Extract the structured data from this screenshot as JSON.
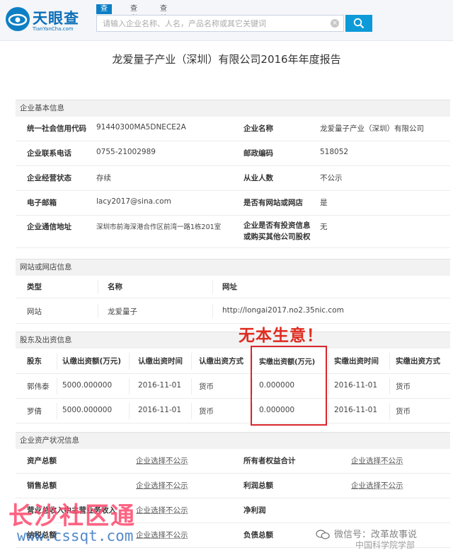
{
  "header": {
    "logo_name": "天眼查",
    "logo_sub": "TianYanCha.com",
    "tabs": [
      "查公司",
      "查老板",
      "查关系"
    ],
    "search_placeholder": "请输入企业名称、人名，产品名称或其它关键词"
  },
  "report_title": "龙爱量子产业（深圳）有限公司2016年年度报告",
  "basic_info": {
    "section_title": "企业基本信息",
    "rows": [
      {
        "l1": "统一社会信用代码",
        "v1": "91440300MA5DNECE2A",
        "l2": "企业名称",
        "v2": "龙爱量子产业（深圳）有限公司"
      },
      {
        "l1": "企业联系电话",
        "v1": "0755-21002989",
        "l2": "邮政编码",
        "v2": "518052"
      },
      {
        "l1": "企业经营状态",
        "v1": "存续",
        "l2": "从业人数",
        "v2": "不公示"
      },
      {
        "l1": "电子邮箱",
        "v1": "lacy2017@sina.com",
        "l2": "是否有网站或网店",
        "v2": "是"
      },
      {
        "l1": "企业通信地址",
        "v1": "深圳市前海深港合作区前湾一路1栋201室",
        "l2a": "企业是否有投资信息",
        "l2b": "或购买其他公司股权",
        "v2": "无"
      }
    ]
  },
  "website_info": {
    "section_title": "网站或网店信息",
    "headers": [
      "类型",
      "名称",
      "网址"
    ],
    "rows": [
      {
        "type": "网站",
        "name": "龙爱量子",
        "url": "http://longai2017.no2.35nic.com"
      }
    ]
  },
  "shareholder_info": {
    "section_title": "股东及出资信息",
    "headers": [
      "股东",
      "认缴出资额(万元)",
      "认缴出资时间",
      "认缴出资方式",
      "实缴出资额(万元)",
      "实缴出资时间",
      "实缴出资方式"
    ],
    "rows": [
      [
        "郭伟泰",
        "5000.000000",
        "2016-11-01",
        "货币",
        "0.000000",
        "2016-11-01",
        "货币"
      ],
      [
        "罗倩",
        "5000.000000",
        "2016-11-01",
        "货币",
        "0.000000",
        "2016-11-01",
        "货币"
      ]
    ]
  },
  "asset_info": {
    "section_title": "企业资产状况信息",
    "rows": [
      {
        "l1": "资产总额",
        "v1": "企业选择不公示",
        "l2": "所有者权益合计",
        "v2": "企业选择不公示"
      },
      {
        "l1": "销售总额",
        "v1": "企业选择不公示",
        "l2": "利润总额",
        "v2": "企业选择不公示"
      },
      {
        "l1": "营业总收入中主营业务收入",
        "v1": "企业选择不公示",
        "l2": "净利润",
        "v2": ""
      },
      {
        "l1": "纳税总额",
        "v1": "企业选择不公示",
        "l2": "负债总额",
        "v2": ""
      }
    ]
  },
  "annotation": "无本生意！",
  "watermarks": {
    "site_name": "长沙社区通",
    "site_url": "www.cssqt.com",
    "wechat": "微信号：改革故事说",
    "org": "中国科学院学部"
  }
}
